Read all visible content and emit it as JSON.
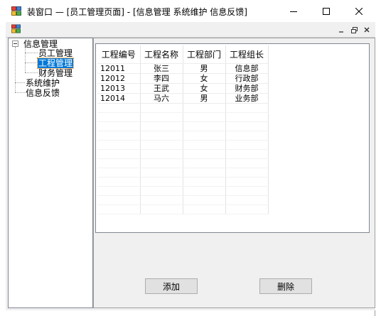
{
  "window": {
    "title": "装窗口 — [员工管理页面] - [信息管理 系统维护 信息反馈]",
    "minimize_glyph": "—",
    "maximize_glyph": "☐",
    "close_glyph": "✕"
  },
  "mdi": {
    "minimize_glyph": "_",
    "restore_glyph": "🗗",
    "close_glyph": "✕"
  },
  "tree": {
    "root_expander": "−",
    "root_label": "信息管理",
    "children": [
      {
        "label": "员工管理",
        "selected": false
      },
      {
        "label": "工程管理",
        "selected": true
      },
      {
        "label": "财务管理",
        "selected": false
      }
    ],
    "siblings": [
      {
        "label": "系统维护"
      },
      {
        "label": "信息反馈"
      }
    ]
  },
  "grid": {
    "columns": [
      "工程编号",
      "工程名称",
      "工程部门",
      "工程组长"
    ],
    "rows": [
      [
        "12011",
        "张三",
        "男",
        "信息部"
      ],
      [
        "12012",
        "李四",
        "女",
        "行政部"
      ],
      [
        "12013",
        "王武",
        "女",
        "财务部"
      ],
      [
        "12014",
        "马六",
        "男",
        "业务部"
      ]
    ]
  },
  "buttons": {
    "add_label": "添加",
    "delete_label": "删除"
  },
  "colors": {
    "selection": "#0078d7",
    "panel_bg": "#f0f0f0",
    "button_bg": "#e1e1e1"
  }
}
